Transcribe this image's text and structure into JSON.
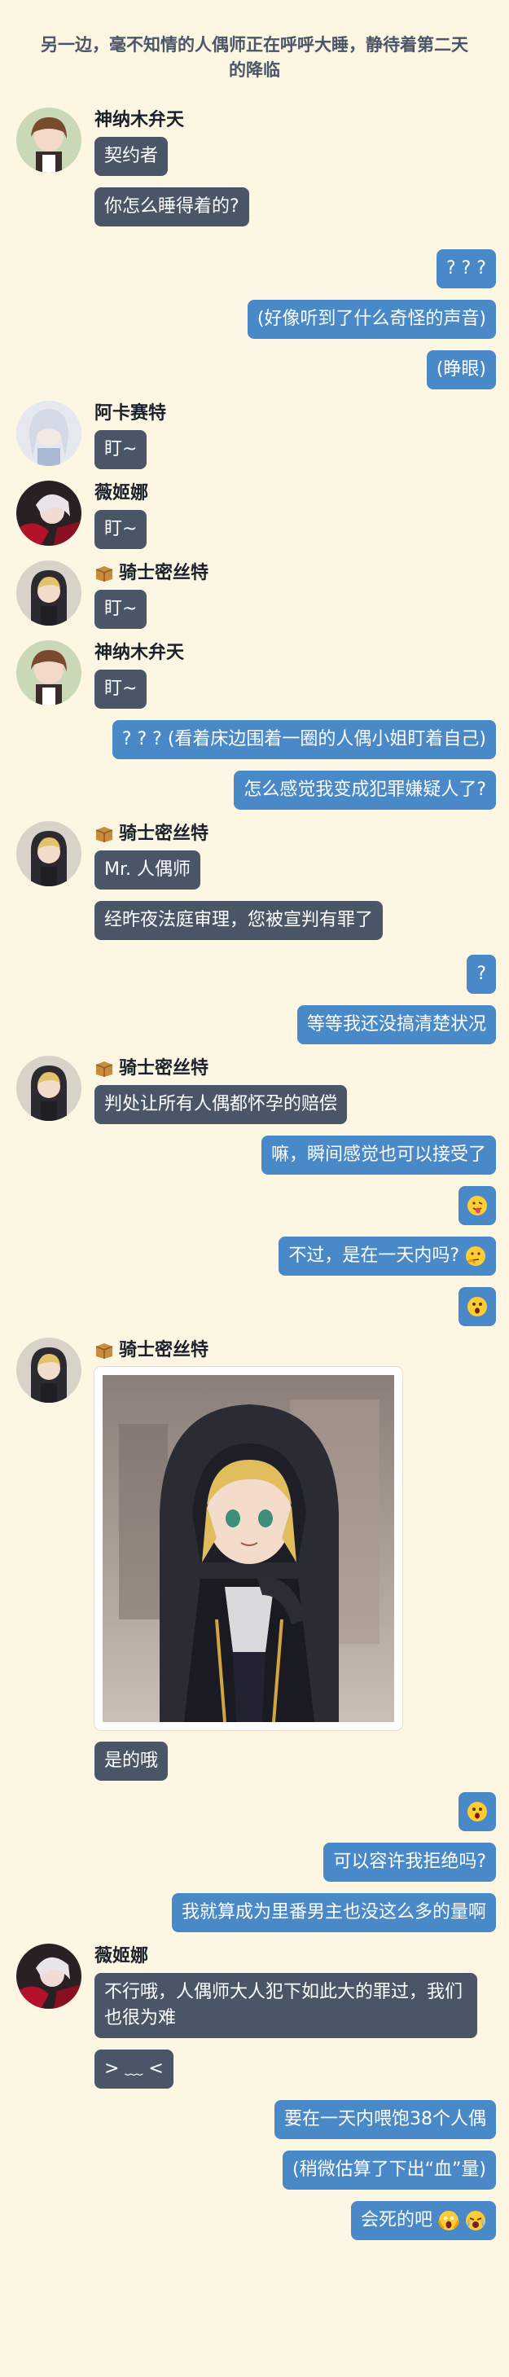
{
  "header": {
    "title": "另一边，毫不知情的人偶师正在呼呼大睡，静待着第二天的降临"
  },
  "characters": {
    "kanna": "神纳木弁天",
    "akasaite": "阿卡赛特",
    "weijina": "薇姬娜",
    "qishi": "骑士密丝特"
  },
  "messages": {
    "m1": "契约者",
    "m2": "你怎么睡得着的?",
    "m3": "? ? ?",
    "m4": "(好像听到了什么奇怪的声音)",
    "m5": "(睁眼)",
    "m6": "盯~",
    "m7": "盯~",
    "m8": "盯~",
    "m9": "盯~",
    "m10": "? ? ?  (看着床边围着一圈的人偶小姐盯着自己)",
    "m11": "怎么感觉我变成犯罪嫌疑人了?",
    "m12": "Mr. 人偶师",
    "m13": "经昨夜法庭审理，您被宣判有罪了",
    "m14": "?",
    "m15": "等等我还没搞清楚状况",
    "m16": "判处让所有人偶都怀孕的赔偿",
    "m17": "嘛，瞬间感觉也可以接受了",
    "m18": "不过，是在一天内吗?",
    "m19": "是的哦",
    "m20": "可以容许我拒绝吗?",
    "m21": "我就算成为里番男主也没这么多的量啊",
    "m22": "不行哦，人偶师大人犯下如此大的罪过，我们也很为难",
    "m23": "> ﹏ <",
    "m24": "要在一天内喂饱38个人偶",
    "m25": "(稍微估算了下出“血”量)",
    "m26": "会死的吧"
  },
  "colors": {
    "background": "#fdf6e3",
    "bubble_left": "#4a5568",
    "bubble_right": "#4a89c8"
  }
}
